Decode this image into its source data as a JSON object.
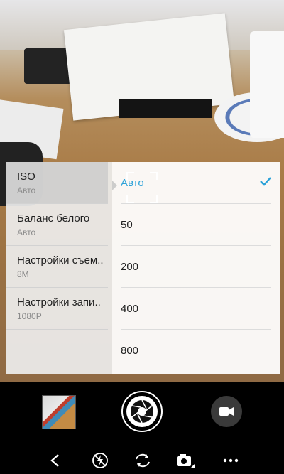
{
  "settings_menu": [
    {
      "title": "ISO",
      "value": "Авто",
      "active": true
    },
    {
      "title": "Баланс белого",
      "value": "Авто",
      "active": false
    },
    {
      "title": "Настройки съем..",
      "value": "8M",
      "active": false
    },
    {
      "title": "Настройки запи..",
      "value": "1080P",
      "active": false
    }
  ],
  "iso_options": [
    {
      "label": "Авто",
      "selected": true
    },
    {
      "label": "50",
      "selected": false
    },
    {
      "label": "200",
      "selected": false
    },
    {
      "label": "400",
      "selected": false
    },
    {
      "label": "800",
      "selected": false
    }
  ],
  "icons": {
    "check": "checkmark-icon",
    "shutter": "aperture-icon",
    "video": "video-camera-icon",
    "back": "back-arrow-icon",
    "flash": "flash-off-icon",
    "switch_camera": "switch-camera-icon",
    "mode": "camera-mode-icon",
    "more": "more-options-icon"
  },
  "colors": {
    "accent": "#2aa1d8",
    "bar_background": "#000000"
  }
}
